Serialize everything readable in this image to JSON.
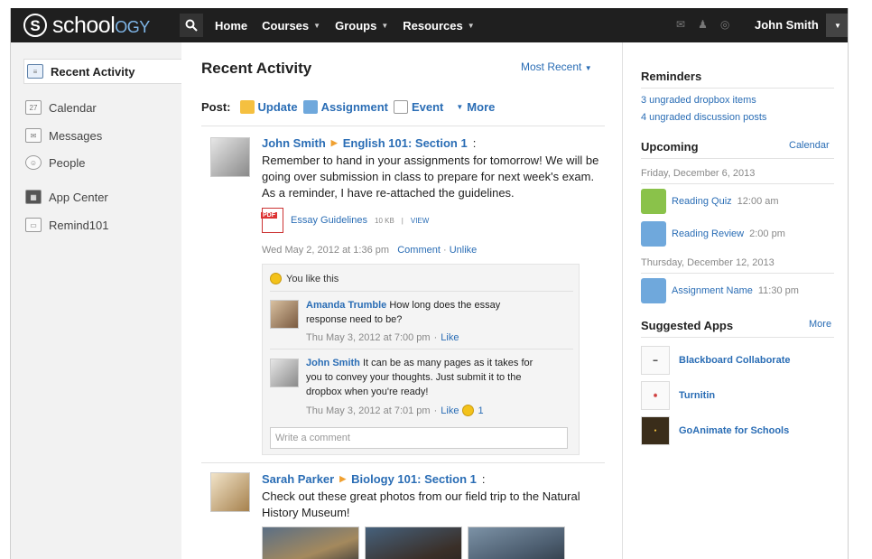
{
  "brand": {
    "name": "schoology",
    "colors": {
      "topbar": "#1f1f1f",
      "link": "#2a6db5",
      "accent": "#f0a030"
    }
  },
  "nav": {
    "search_icon": "search-icon",
    "items": [
      {
        "label": "Home"
      },
      {
        "label": "Courses"
      },
      {
        "label": "Groups"
      },
      {
        "label": "Resources"
      }
    ],
    "user_name": "John Smith",
    "icons": [
      "mail-icon",
      "users-icon",
      "bell-icon"
    ]
  },
  "sidebar": {
    "items": [
      {
        "label": "Recent Activity",
        "icon": "activity-icon"
      },
      {
        "label": "Calendar",
        "icon": "calendar-icon",
        "badge": "27"
      },
      {
        "label": "Messages",
        "icon": "envelope-icon"
      },
      {
        "label": "People",
        "icon": "person-icon"
      },
      {
        "label": "App Center",
        "icon": "app-icon"
      },
      {
        "label": "Remind101",
        "icon": "remind-icon"
      }
    ]
  },
  "main": {
    "title": "Recent Activity",
    "sort_label": "Most Recent",
    "post_label": "Post:",
    "post_actions": {
      "update": "Update",
      "assignment": "Assignment",
      "event": "Event",
      "more": "More"
    },
    "posts": [
      {
        "author": "John Smith",
        "course": "English 101: Section 1",
        "text_lines": [
          "Remember to hand in your assignments for tomorrow! We will be",
          "going over submission in class to prepare for next week's exam.",
          "As a reminder, I have re-attached the guidelines."
        ],
        "attachment": {
          "name": "Essay Guidelines",
          "size": "10 KB",
          "view": "VIEW"
        },
        "timestamp": "Wed May 2, 2012 at 1:36 pm",
        "comment_link": "Comment",
        "unlike_link": "Unlike",
        "likes_text": "You like this",
        "comments": [
          {
            "author": "Amanda Trumble",
            "text_lines": [
              "How long does the essay",
              "response need to be?"
            ],
            "timestamp": "Thu May 3, 2012 at 7:00 pm",
            "like_label": "Like"
          },
          {
            "author": "John Smith",
            "text_lines": [
              "It can be as many pages as it takes for",
              "you to convey your thoughts. Just submit it to the",
              "dropbox when you're ready!"
            ],
            "timestamp": "Thu May 3, 2012 at 7:01 pm",
            "like_label": "Like",
            "like_count": "1"
          }
        ],
        "comment_placeholder": "Write a comment"
      },
      {
        "author": "Sarah Parker",
        "course": "Biology 101: Section 1",
        "text_lines": [
          "Check out these great photos from our field trip to the Natural",
          "History Museum!"
        ]
      }
    ]
  },
  "right": {
    "reminders_title": "Reminders",
    "reminders": [
      "3 ungraded dropbox items",
      "4 ungraded discussion posts"
    ],
    "upcoming_title": "Upcoming",
    "calendar_link": "Calendar",
    "upcoming": [
      {
        "date": "Friday, December 6, 2013",
        "events": [
          {
            "name": "Reading Quiz",
            "time": "12:00 am",
            "icon": "puzzle-icon"
          },
          {
            "name": "Reading Review",
            "time": "2:00 pm",
            "icon": "assignment-icon"
          }
        ]
      },
      {
        "date": "Thursday, December 12, 2013",
        "events": [
          {
            "name": "Assignment Name",
            "time": "11:30 pm",
            "icon": "assignment-icon"
          }
        ]
      }
    ],
    "apps_title": "Suggested Apps",
    "apps_more": "More",
    "apps": [
      {
        "name": "Blackboard Collaborate"
      },
      {
        "name": "Turnitin"
      },
      {
        "name": "GoAnimate for Schools"
      }
    ]
  }
}
